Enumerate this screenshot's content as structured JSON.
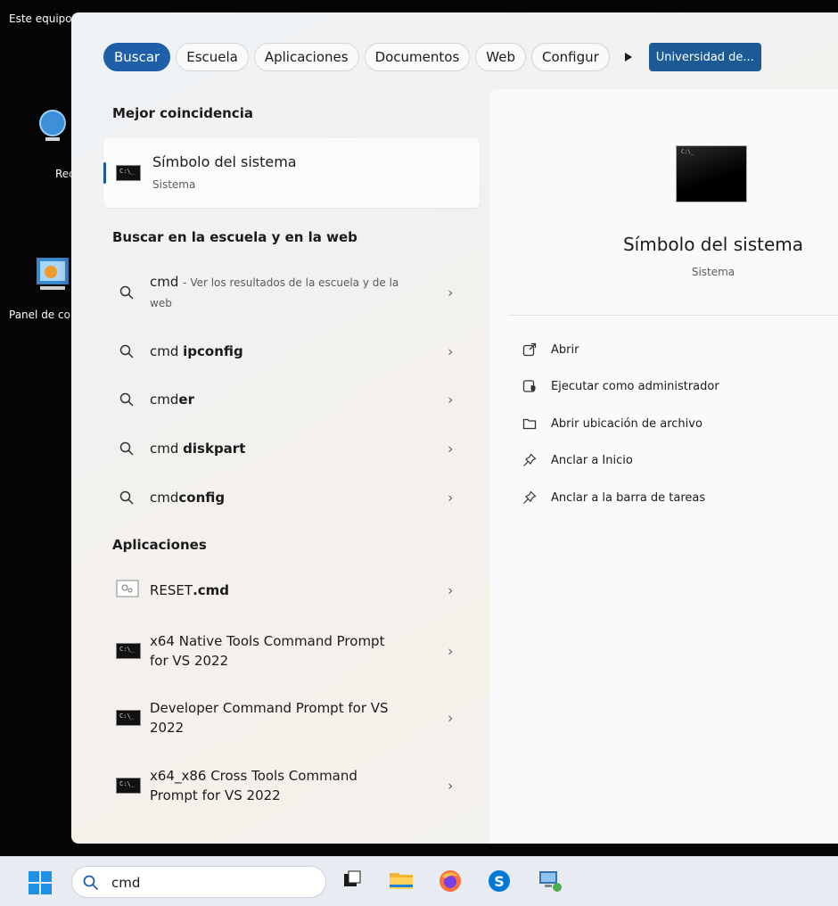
{
  "desktop": {
    "icons": [
      "Este equipo",
      "Red",
      "Panel de control"
    ]
  },
  "filters": {
    "tabs": [
      "Buscar",
      "Escuela",
      "Aplicaciones",
      "Documentos",
      "Web",
      "Configur"
    ],
    "organization": "Universidad de..."
  },
  "best_match": {
    "heading": "Mejor coincidencia",
    "title": "Símbolo del sistema",
    "subtitle": "Sistema"
  },
  "web_section": {
    "heading": "Buscar en la escuela y en la web",
    "first": {
      "query": "cmd",
      "hint": "- Ver los resultados de la escuela y de la web"
    },
    "suggestions": [
      {
        "prefix": "cmd ",
        "bold": "ipconfig"
      },
      {
        "prefix": "cmd",
        "bold": "er"
      },
      {
        "prefix": "cmd ",
        "bold": "diskpart"
      },
      {
        "prefix": "cmd",
        "bold": "config"
      }
    ]
  },
  "apps_section": {
    "heading": "Aplicaciones",
    "reset": {
      "prefix": "RESET",
      "bold": ".cmd"
    },
    "items": [
      "x64 Native Tools Command Prompt for VS 2022",
      "Developer Command Prompt for VS 2022",
      "x64_x86 Cross Tools Command Prompt for VS 2022"
    ]
  },
  "preview": {
    "title": "Símbolo del sistema",
    "subtitle": "Sistema",
    "actions": [
      {
        "label": "Abrir",
        "icon": "open-icon"
      },
      {
        "label": "Ejecutar como administrador",
        "icon": "shield-admin-icon"
      },
      {
        "label": "Abrir ubicación de archivo",
        "icon": "folder-icon"
      },
      {
        "label": "Anclar a Inicio",
        "icon": "pin-icon"
      },
      {
        "label": "Anclar a la barra de tareas",
        "icon": "pin-icon"
      }
    ]
  },
  "taskbar": {
    "search_value": "cmd",
    "apps": [
      "task-view-icon",
      "file-explorer-icon",
      "firefox-icon",
      "skype-icon",
      "remote-desktop-icon"
    ]
  },
  "colors": {
    "accent": "#1f5fa8",
    "org_button": "#1c5a96"
  }
}
